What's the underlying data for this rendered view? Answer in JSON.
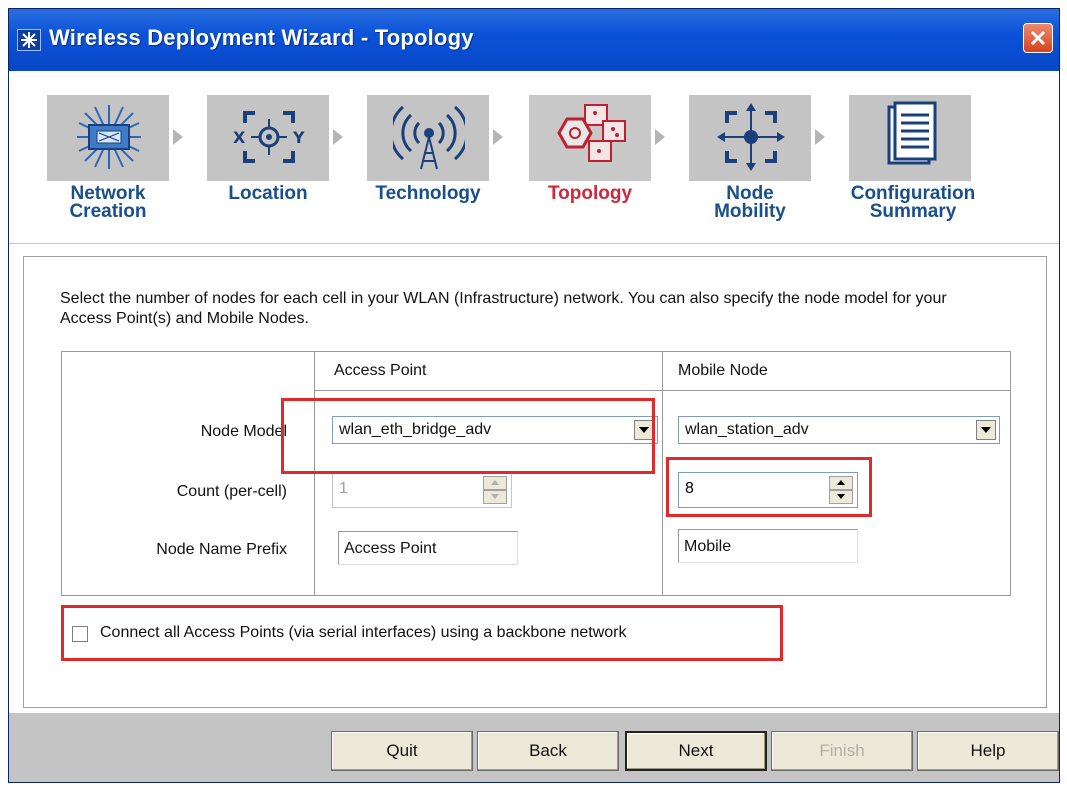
{
  "window": {
    "title": "Wireless Deployment Wizard - Topology"
  },
  "steps": [
    {
      "label_line1": "Network",
      "label_line2": "Creation",
      "icon": "network-creation-icon",
      "active": false
    },
    {
      "label_line1": "Location",
      "label_line2": "",
      "icon": "location-crosshair-icon",
      "active": false
    },
    {
      "label_line1": "Technology",
      "label_line2": "",
      "icon": "wireless-antenna-icon",
      "active": false
    },
    {
      "label_line1": "Topology",
      "label_line2": "",
      "icon": "topology-cells-icon",
      "active": true
    },
    {
      "label_line1": "Node",
      "label_line2": "Mobility",
      "icon": "node-mobility-icon",
      "active": false
    },
    {
      "label_line1": "Configuration",
      "label_line2": "Summary",
      "icon": "document-icon",
      "active": false
    }
  ],
  "main": {
    "intro": "Select the number of nodes for each cell in your WLAN (Infrastructure) network. You can also specify the node model for your Access Point(s) and Mobile Nodes.",
    "columns": {
      "access_point": "Access Point",
      "mobile_node": "Mobile Node"
    },
    "rows": {
      "node_model": "Node Model",
      "count": "Count (per-cell)",
      "prefix": "Node Name Prefix"
    },
    "access_point": {
      "model": "wlan_eth_bridge_adv",
      "count": "1",
      "prefix": "Access Point"
    },
    "mobile_node": {
      "model": "wlan_station_adv",
      "count": "8",
      "prefix": "Mobile"
    },
    "backbone_checkbox": {
      "label": "Connect all Access Points (via serial interfaces) using a backbone network",
      "checked": false
    }
  },
  "footer": {
    "quit": "Quit",
    "back": "Back",
    "next": "Next",
    "finish": "Finish",
    "help": "Help"
  },
  "colors": {
    "titlebar": "#0b52d8",
    "step_label": "#1a4f8a",
    "active_step_label": "#d0283a",
    "highlight_box": "#e0292b"
  }
}
